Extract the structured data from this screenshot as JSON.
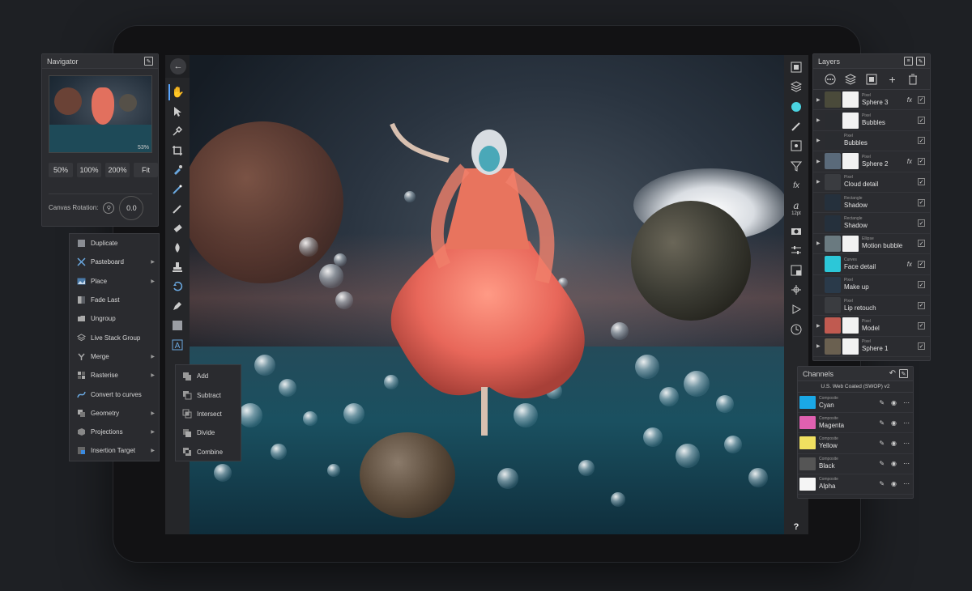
{
  "navigator": {
    "title": "Navigator",
    "zoom_readout": "53%",
    "zoom_buttons": [
      "50%",
      "100%",
      "200%",
      "Fit"
    ],
    "rotation_label": "Canvas Rotation:",
    "rotation_value": "0.0"
  },
  "context_menu": {
    "items": [
      {
        "label": "Duplicate",
        "icon": "duplicate-icon",
        "submenu": false
      },
      {
        "label": "Pasteboard",
        "icon": "scissors-icon",
        "submenu": true
      },
      {
        "label": "Place",
        "icon": "image-icon",
        "submenu": true
      },
      {
        "label": "Fade Last",
        "icon": "fade-icon",
        "submenu": false
      },
      {
        "label": "Ungroup",
        "icon": "folder-icon",
        "submenu": false
      },
      {
        "label": "Live Stack Group",
        "icon": "stack-icon",
        "submenu": false
      },
      {
        "label": "Merge",
        "icon": "merge-icon",
        "submenu": true
      },
      {
        "label": "Rasterise",
        "icon": "rasterise-icon",
        "submenu": true
      },
      {
        "label": "Convert to curves",
        "icon": "curves-icon",
        "submenu": false
      },
      {
        "label": "Geometry",
        "icon": "geometry-icon",
        "submenu": true
      },
      {
        "label": "Projections",
        "icon": "projections-icon",
        "submenu": true
      },
      {
        "label": "Insertion Target",
        "icon": "insertion-icon",
        "submenu": true
      }
    ]
  },
  "geometry_submenu": {
    "items": [
      "Add",
      "Subtract",
      "Intersect",
      "Divide",
      "Combine"
    ]
  },
  "layers": {
    "title": "Layers",
    "rows": [
      {
        "type": "Pixel",
        "name": "Sphere 3",
        "thumb": "#4a4a3a",
        "mask": true,
        "fx": true,
        "expand": true
      },
      {
        "type": "Pixel",
        "name": "Bubbles",
        "thumb": "#2a2c30",
        "mask": true,
        "fx": false,
        "expand": true
      },
      {
        "type": "Pixel",
        "name": "Bubbles",
        "thumb": "#2a2c30",
        "mask": false,
        "fx": false,
        "expand": true
      },
      {
        "type": "Pixel",
        "name": "Sphere 2",
        "thumb": "#5a6a7a",
        "mask": true,
        "fx": true,
        "expand": true
      },
      {
        "type": "Pixel",
        "name": "Cloud detail",
        "thumb": "#3a3c40",
        "mask": false,
        "fx": false,
        "expand": true
      },
      {
        "type": "Rectangle",
        "name": "Shadow",
        "thumb": "#25303c",
        "mask": false,
        "fx": false,
        "expand": false
      },
      {
        "type": "Rectangle",
        "name": "Shadow",
        "thumb": "#25303c",
        "mask": false,
        "fx": false,
        "expand": false
      },
      {
        "type": "Ellipse",
        "name": "Motion bubble",
        "thumb": "#6a7a80",
        "mask": true,
        "fx": false,
        "expand": true
      },
      {
        "type": "Curves",
        "name": "Face detail",
        "thumb": "#2cc7d8",
        "mask": false,
        "fx": true,
        "expand": false
      },
      {
        "type": "Pixel",
        "name": "Make up",
        "thumb": "#2a3a4a",
        "mask": false,
        "fx": false,
        "expand": false
      },
      {
        "type": "Pixel",
        "name": "Lip retouch",
        "thumb": "#3a3c40",
        "mask": false,
        "fx": false,
        "expand": false
      },
      {
        "type": "Pixel",
        "name": "Model",
        "thumb": "#c05a50",
        "mask": true,
        "fx": false,
        "expand": true
      },
      {
        "type": "Pixel",
        "name": "Sphere 1",
        "thumb": "#6a6050",
        "mask": true,
        "fx": false,
        "expand": true
      }
    ]
  },
  "channels": {
    "title": "Channels",
    "profile": "U.S. Web Coated (SWOP) v2",
    "rows": [
      {
        "type": "Composite",
        "name": "Cyan",
        "swatch": "#1aa8e6"
      },
      {
        "type": "Composite",
        "name": "Magenta",
        "swatch": "#e060b0"
      },
      {
        "type": "Composite",
        "name": "Yellow",
        "swatch": "#f0e060"
      },
      {
        "type": "Composite",
        "name": "Black",
        "swatch": "#555555"
      },
      {
        "type": "Composite",
        "name": "Alpha",
        "swatch": "#f5f5f5"
      }
    ]
  },
  "right_tools": {
    "text_size": "12pt"
  },
  "colors": {
    "accent": "#5aa6ff",
    "current_color": "#4ad3e0",
    "persona_photo": "#8a5cf6"
  }
}
